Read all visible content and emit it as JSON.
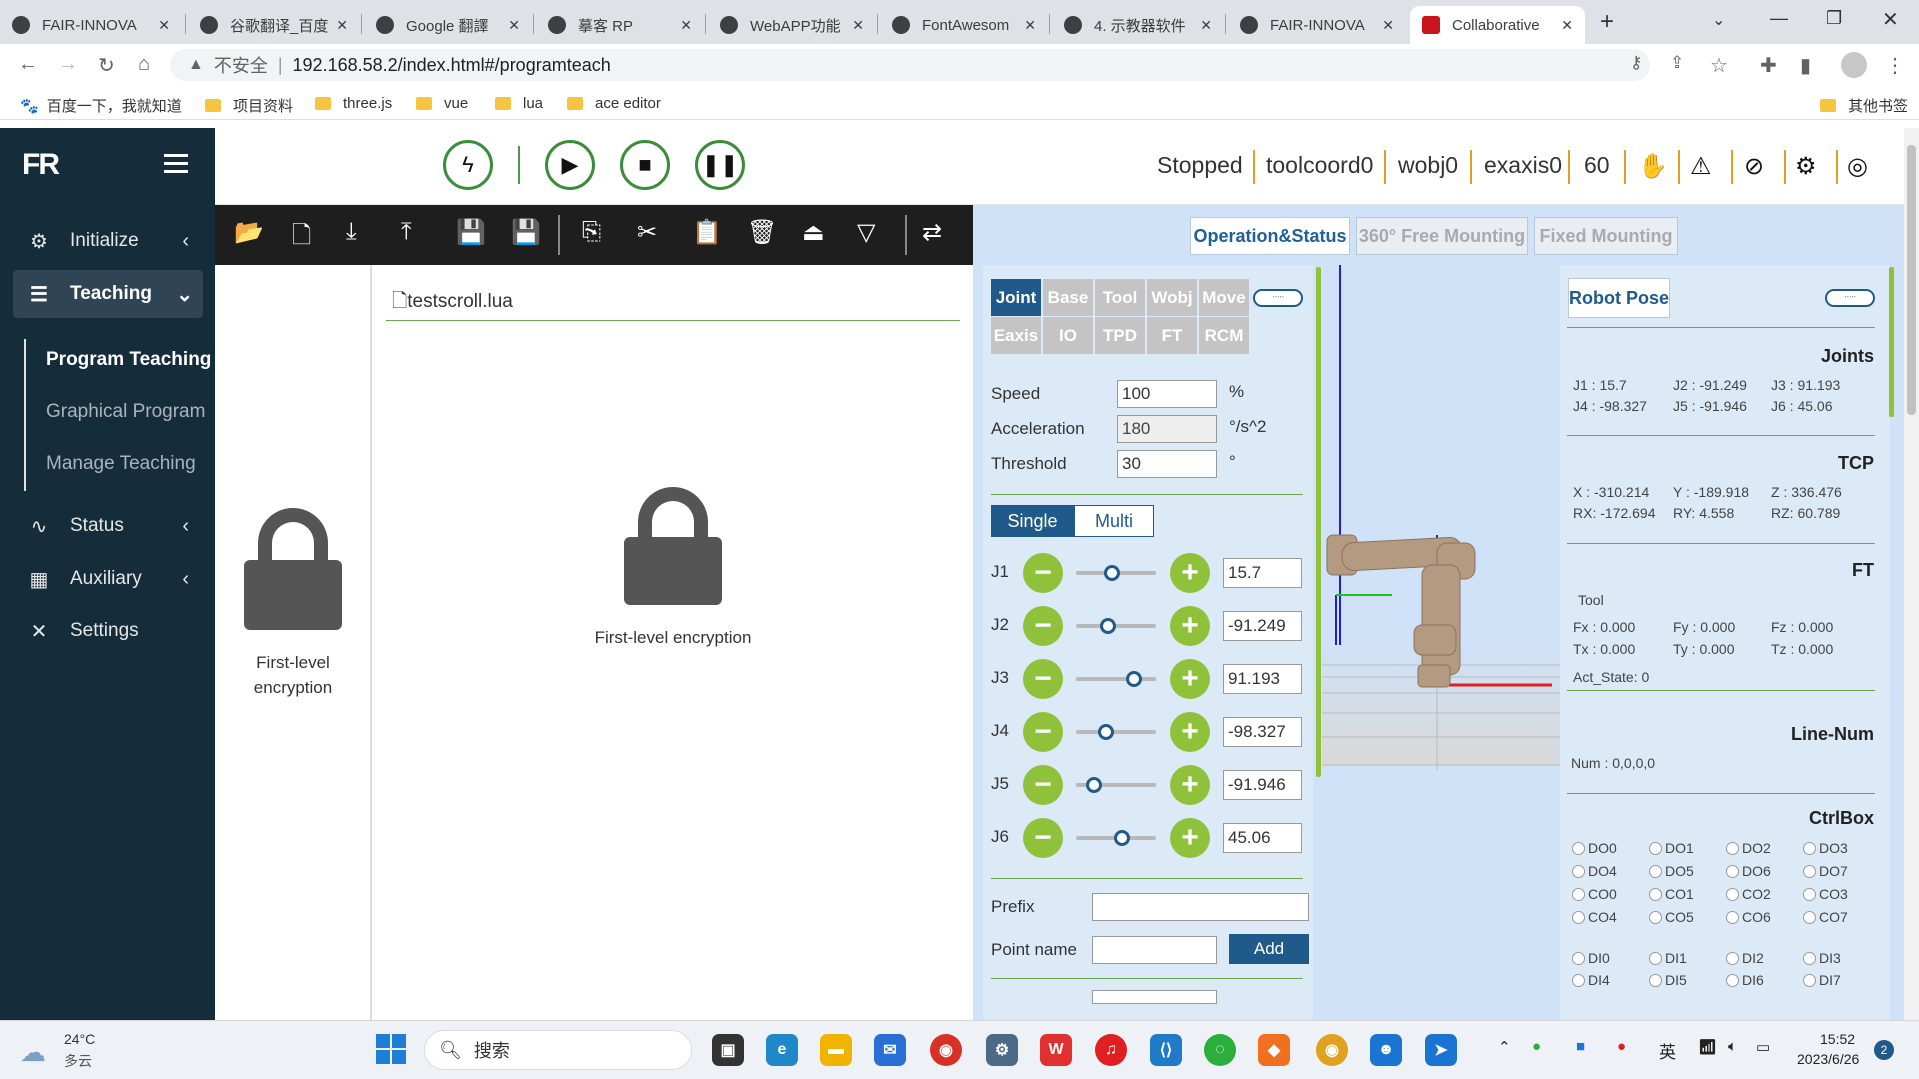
{
  "browser": {
    "tabs": [
      {
        "title": "FAIR-INNOVA",
        "icon": "github-icon",
        "active": false
      },
      {
        "title": "谷歌翻译_百度",
        "icon": "baidu-icon",
        "active": false
      },
      {
        "title": "Google 翻譯",
        "icon": "google-translate-icon",
        "active": false
      },
      {
        "title": "摹客 RP",
        "icon": "mockplus-icon",
        "active": false
      },
      {
        "title": "WebAPP功能",
        "icon": "mockplus-icon",
        "active": false
      },
      {
        "title": "FontAwesom",
        "icon": "fontawesome-icon",
        "active": false
      },
      {
        "title": "4. 示教器软件",
        "icon": "doc-icon",
        "active": false
      },
      {
        "title": "FAIR-INNOVA",
        "icon": "github-icon",
        "active": false
      },
      {
        "title": "Collaborative",
        "icon": "fr-icon",
        "active": true
      }
    ],
    "new_tab": "+",
    "security_label": "不安全",
    "url": "192.168.58.2/index.html#/programteach",
    "bookmarks": [
      "百度一下，我就知道",
      "项目资料",
      "three.js",
      "vue",
      "lua",
      "ace editor"
    ],
    "other_bookmarks": "其他书签"
  },
  "sidebar": {
    "logo": "FR",
    "items": [
      {
        "label": "Initialize",
        "icon": "gear-icon"
      },
      {
        "label": "Teaching",
        "icon": "list-icon"
      },
      {
        "label": "Status",
        "icon": "pulse-icon"
      },
      {
        "label": "Auxiliary",
        "icon": "grid-icon"
      },
      {
        "label": "Settings",
        "icon": "tools-icon"
      }
    ],
    "sub_items": [
      "Program Teaching",
      "Graphical Program",
      "Manage Teaching"
    ]
  },
  "header": {
    "status": "Stopped",
    "toolcoord": "toolcoord0",
    "wobj": "wobj0",
    "exaxis": "exaxis0",
    "speed": "60"
  },
  "editor": {
    "filename": "testscroll.lua",
    "lock_text": "First-level encryption",
    "lock_text_side": [
      "First-level",
      "encryption"
    ]
  },
  "mode_tabs": [
    "Operation&Status",
    "360° Free Mounting",
    "Fixed Mounting"
  ],
  "jog": {
    "tabs_row1": [
      "Joint",
      "Base",
      "Tool",
      "Wobj",
      "Move"
    ],
    "tabs_row2": [
      "Eaxis",
      "IO",
      "TPD",
      "FT",
      "RCM"
    ],
    "speed_label": "Speed",
    "speed": "100",
    "speed_unit": "%",
    "acc_label": "Acceleration",
    "acc": "180",
    "acc_unit": "°/s^2",
    "thr_label": "Threshold",
    "thr": "30",
    "thr_unit": "°",
    "single": "Single",
    "multi": "Multi",
    "joints": [
      {
        "name": "J1",
        "value": "15.7",
        "pos": 0.45
      },
      {
        "name": "J2",
        "value": "-91.249",
        "pos": 0.4
      },
      {
        "name": "J3",
        "value": "91.193",
        "pos": 0.72
      },
      {
        "name": "J4",
        "value": "-98.327",
        "pos": 0.38
      },
      {
        "name": "J5",
        "value": "-91.946",
        "pos": 0.22
      },
      {
        "name": "J6",
        "value": "45.06",
        "pos": 0.58
      }
    ],
    "prefix_label": "Prefix",
    "point_label": "Point name",
    "add_label": "Add"
  },
  "pose": {
    "title": "Robot Pose",
    "joints_title": "Joints",
    "joints": [
      "J1 : 15.7",
      "J2 : -91.249",
      "J3 : 91.193",
      "J4 : -98.327",
      "J5 : -91.946",
      "J6 : 45.06"
    ],
    "tcp_title": "TCP",
    "tcp": [
      "X : -310.214",
      "Y : -189.918",
      "Z : 336.476",
      "RX: -172.694",
      "RY: 4.558",
      "RZ: 60.789"
    ],
    "ft_title": "FT",
    "ft_tool": "Tool",
    "ft": [
      "Fx : 0.000",
      "Fy : 0.000",
      "Fz : 0.000",
      "Tx : 0.000",
      "Ty : 0.000",
      "Tz : 0.000"
    ],
    "act_state": "Act_State: 0",
    "linenum_title": "Line-Num",
    "num_label": "Num  :  0,0,0,0",
    "ctrlbox_title": "CtrlBox",
    "do_list": [
      "DO0",
      "DO1",
      "DO2",
      "DO3",
      "DO4",
      "DO5",
      "DO6",
      "DO7",
      "CO0",
      "CO1",
      "CO2",
      "CO3",
      "CO4",
      "CO5",
      "CO6",
      "CO7"
    ],
    "di_list": [
      "DI0",
      "DI1",
      "DI2",
      "DI3",
      "DI4",
      "DI5",
      "DI6",
      "DI7"
    ]
  },
  "taskbar": {
    "weather_temp": "24°C",
    "weather_desc": "多云",
    "search": "搜索",
    "ime": "英",
    "time": "15:52",
    "date": "2023/6/26",
    "notif": "2"
  }
}
